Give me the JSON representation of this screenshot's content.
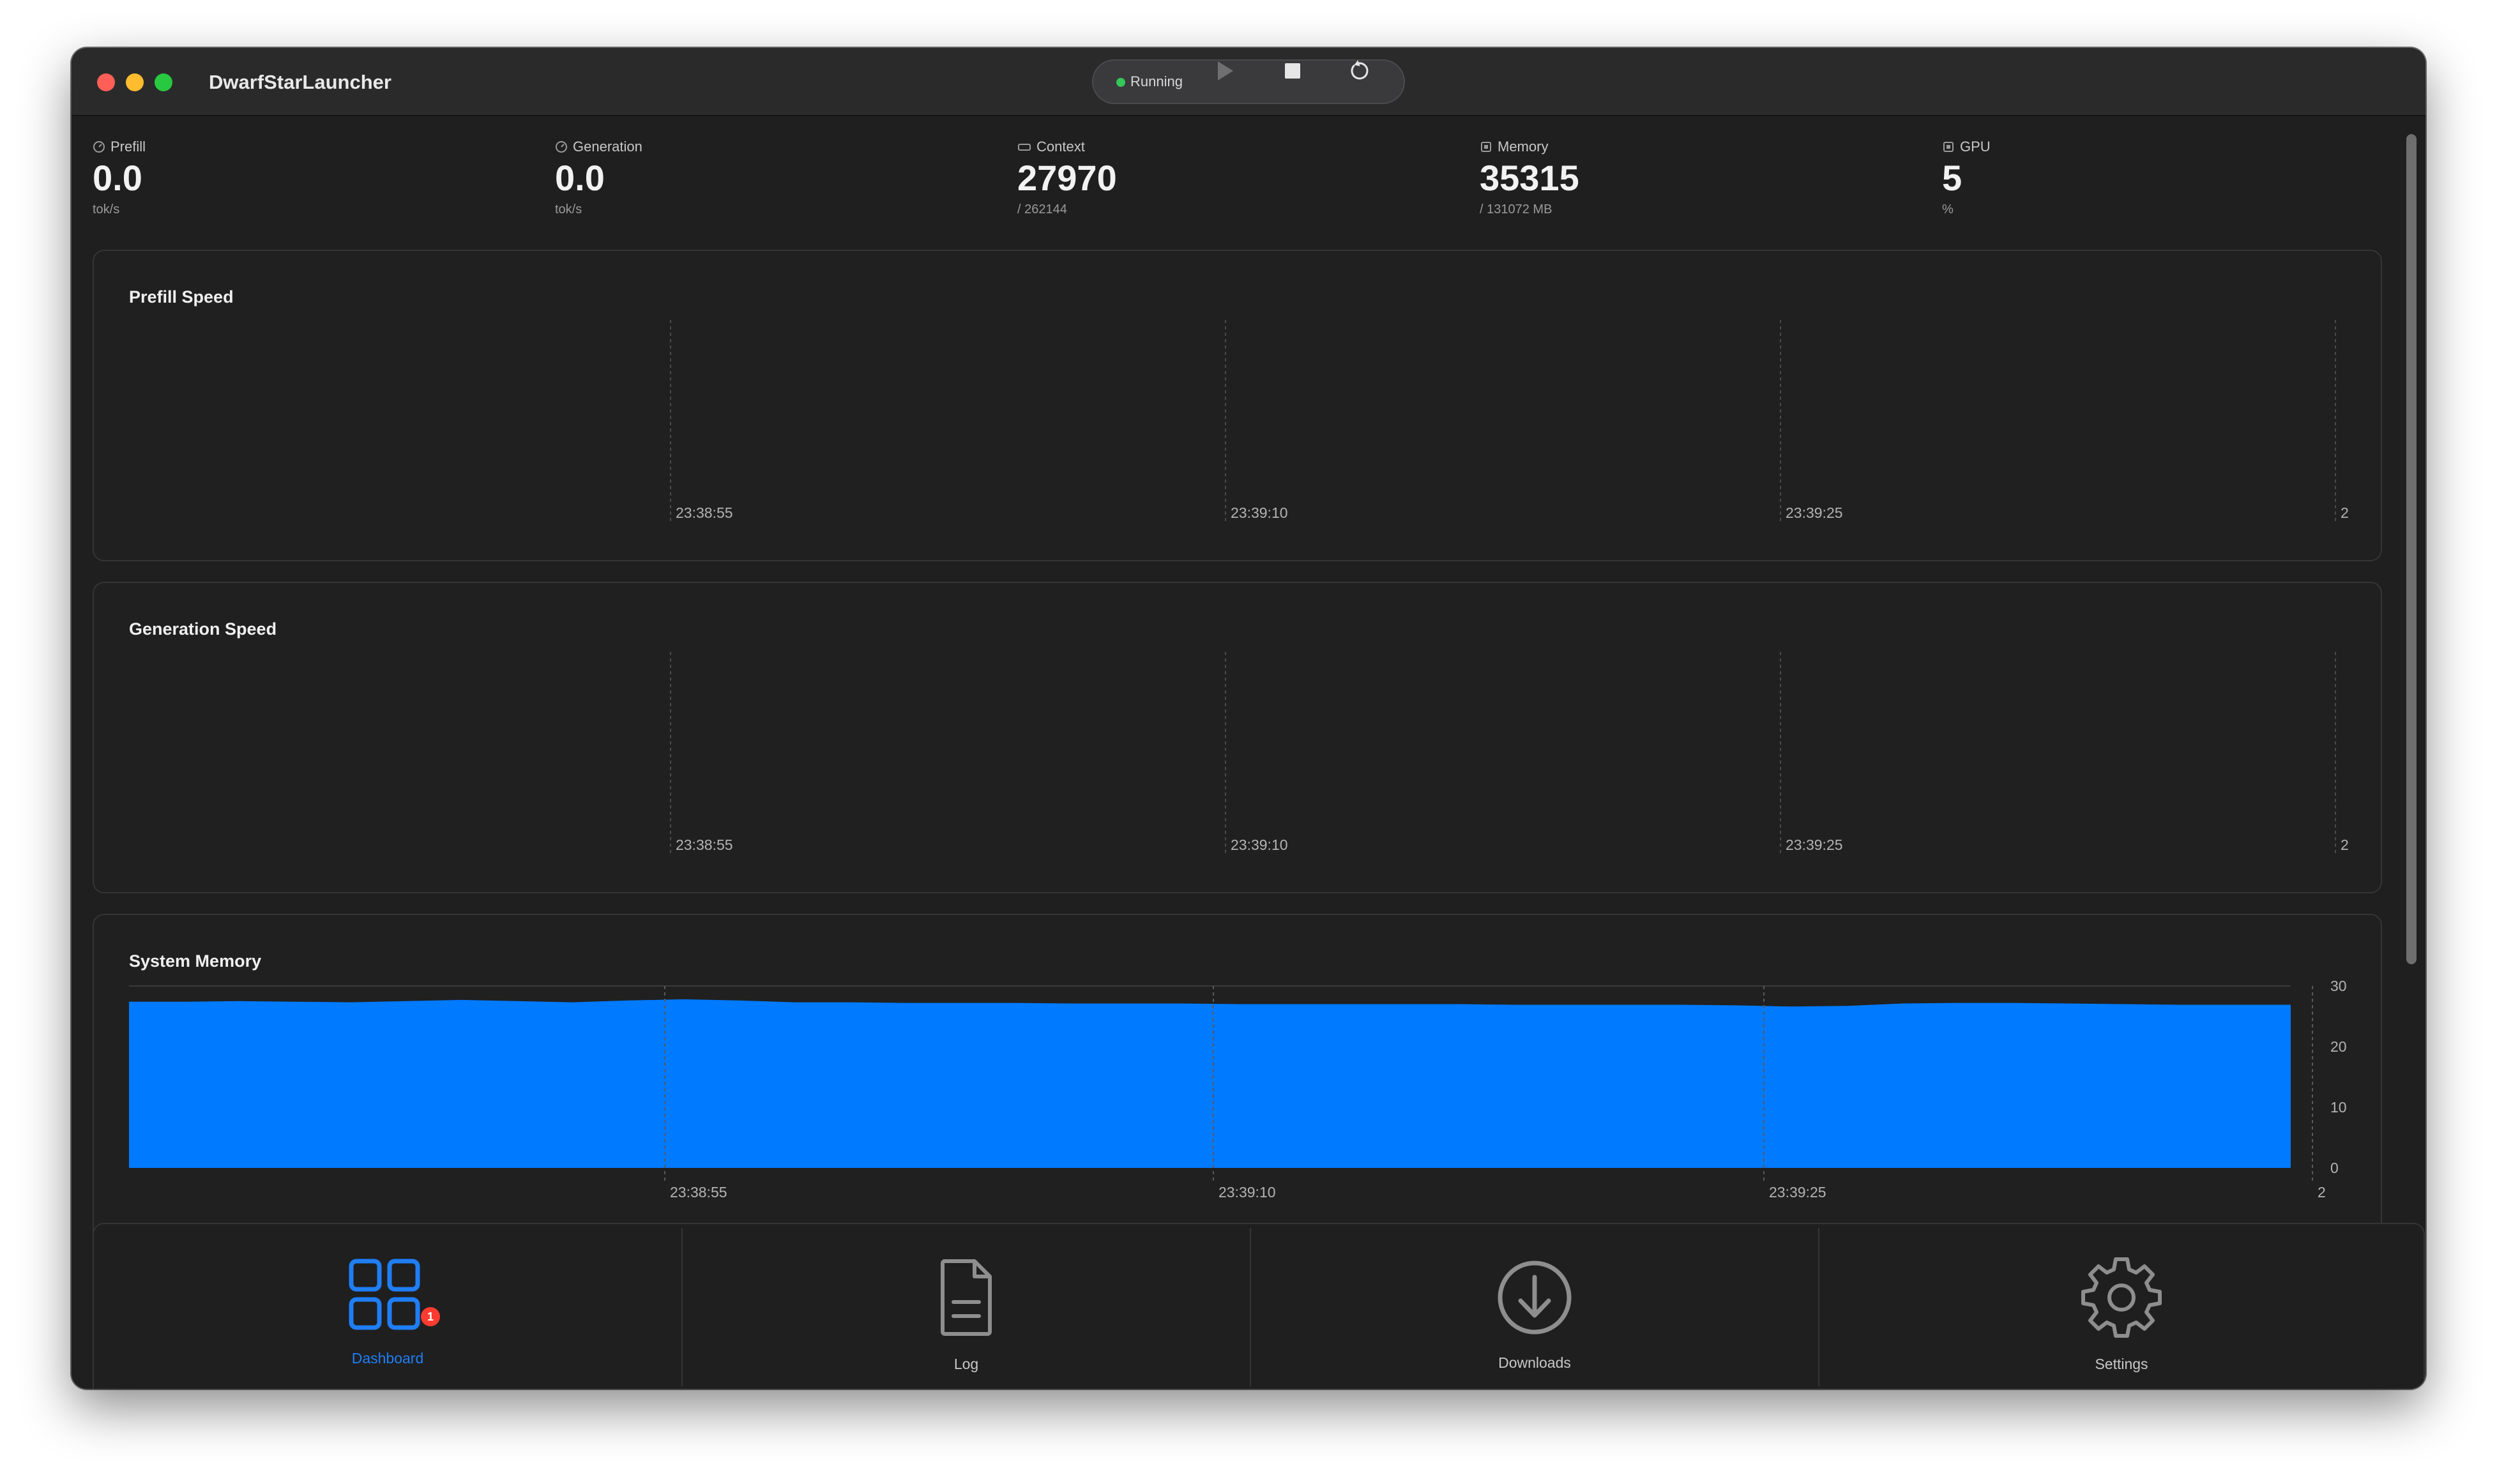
{
  "app": {
    "title": "DwarfStarLauncher"
  },
  "controls": {
    "status": "Running",
    "status_color": "#34c759"
  },
  "stats": [
    {
      "label": "Prefill",
      "value": "0.0",
      "unit": "tok/s",
      "icon": "gauge-icon"
    },
    {
      "label": "Generation",
      "value": "0.0",
      "unit": "tok/s",
      "icon": "gauge-icon"
    },
    {
      "label": "Context",
      "value": "27970",
      "unit": "/ 262144",
      "icon": "context-icon"
    },
    {
      "label": "Memory",
      "value": "35315",
      "unit": "/ 131072 MB",
      "icon": "memory-chip-icon"
    },
    {
      "label": "GPU",
      "value": "5",
      "unit": "%",
      "icon": "gpu-chip-icon"
    }
  ],
  "panels": {
    "prefill": {
      "title": "Prefill Speed"
    },
    "generation": {
      "title": "Generation Speed"
    },
    "memory": {
      "title": "System Memory"
    }
  },
  "chart_data": [
    {
      "type": "line",
      "title": "Prefill Speed",
      "x_ticks": [
        "23:38:55",
        "23:39:10",
        "23:39:25",
        "2"
      ],
      "series": [],
      "grid": true
    },
    {
      "type": "line",
      "title": "Generation Speed",
      "x_ticks": [
        "23:38:55",
        "23:39:10",
        "23:39:25",
        "2"
      ],
      "series": [],
      "grid": true
    },
    {
      "type": "area",
      "title": "System Memory",
      "x_ticks": [
        "23:38:55",
        "23:39:10",
        "23:39:25",
        "2"
      ],
      "y_ticks": [
        "0",
        "10",
        "20",
        "30"
      ],
      "ylim": [
        0,
        30
      ],
      "color": "#007aff",
      "series": [
        {
          "values": [
            27.4,
            27.4,
            27.5,
            27.4,
            27.3,
            27.5,
            27.7,
            27.5,
            27.3,
            27.6,
            27.8,
            27.6,
            27.3,
            27.3,
            27.2,
            27.2,
            27.2,
            27.1,
            27.1,
            27.1,
            27.0,
            27.0,
            27.0,
            27.0,
            27.0,
            26.9,
            26.9,
            26.9,
            26.9,
            26.8,
            26.6,
            26.7,
            27.1,
            27.2,
            27.2,
            27.1,
            27.0,
            26.9,
            26.9,
            26.9
          ]
        }
      ],
      "grid": true
    }
  ],
  "tabs": [
    {
      "label": "Dashboard",
      "icon": "dashboard-grid-icon",
      "active": true,
      "badge": "1"
    },
    {
      "label": "Log",
      "icon": "document-icon",
      "active": false
    },
    {
      "label": "Downloads",
      "icon": "download-circle-icon",
      "active": false
    },
    {
      "label": "Settings",
      "icon": "gear-icon",
      "active": false
    }
  ],
  "colors": {
    "accent": "#1f7ef5",
    "badge": "#ff3b30",
    "chart_fill": "#007aff"
  }
}
